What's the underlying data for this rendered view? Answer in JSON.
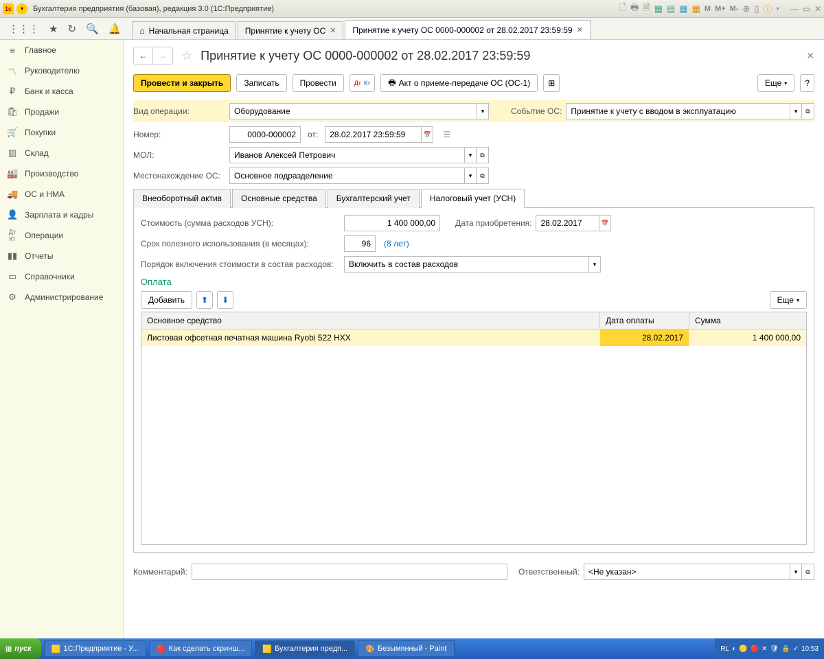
{
  "titlebar": {
    "text": "Бухгалтерия предприятия (базовая), редакция 3.0  (1С:Предприятие)",
    "m_items": [
      "M",
      "M+",
      "M-"
    ]
  },
  "tabs": {
    "home": "Начальная страница",
    "items": [
      "Принятие к учету ОС",
      "Принятие к учету ОС 0000-000002 от 28.02.2017 23:59:59"
    ],
    "active": 1
  },
  "sidebar": [
    {
      "icon": "≡",
      "label": "Главное"
    },
    {
      "icon": "📈",
      "label": "Руководителю"
    },
    {
      "icon": "₽",
      "label": "Банк и касса"
    },
    {
      "icon": "🛍",
      "label": "Продажи"
    },
    {
      "icon": "🛒",
      "label": "Покупки"
    },
    {
      "icon": "📊",
      "label": "Склад"
    },
    {
      "icon": "🏭",
      "label": "Производство"
    },
    {
      "icon": "🚚",
      "label": "ОС и НМА"
    },
    {
      "icon": "👤",
      "label": "Зарплата и кадры"
    },
    {
      "icon": "Дт",
      "label": "Операции"
    },
    {
      "icon": "📶",
      "label": "Отчеты"
    },
    {
      "icon": "📁",
      "label": "Справочники"
    },
    {
      "icon": "⚙",
      "label": "Администрирование"
    }
  ],
  "page": {
    "title": "Принятие к учету ОС 0000-000002 от 28.02.2017 23:59:59"
  },
  "toolbar": {
    "post_close": "Провести и закрыть",
    "write": "Записать",
    "post": "Провести",
    "act": "Акт о приеме-передаче ОС (ОС-1)",
    "more": "Еще",
    "help": "?"
  },
  "form": {
    "operation_label": "Вид операции:",
    "operation_value": "Оборудование",
    "event_label": "Событие ОС:",
    "event_value": "Принятие к учету с вводом в эксплуатацию",
    "number_label": "Номер:",
    "number_value": "0000-000002",
    "from_label": "от:",
    "date_value": "28.02.2017 23:59:59",
    "mol_label": "МОЛ:",
    "mol_value": "Иванов Алексей Петрович",
    "location_label": "Местонахождение ОС:",
    "location_value": "Основное подразделение"
  },
  "inner_tabs": [
    "Внеоборотный актив",
    "Основные средства",
    "Бухгалтерский учет",
    "Налоговый учет (УСН)"
  ],
  "inner_active": 3,
  "tax_panel": {
    "cost_label": "Стоимость (сумма расходов УСН):",
    "cost_value": "1 400 000,00",
    "acq_date_label": "Дата приобретения:",
    "acq_date_value": "28.02.2017",
    "life_label": "Срок полезного использования (в месяцах):",
    "life_value": "96",
    "life_hint": "(8 лет)",
    "order_label": "Порядок включения стоимости в состав расходов:",
    "order_value": "Включить в состав расходов",
    "section": "Оплата",
    "add_btn": "Добавить",
    "more": "Еще"
  },
  "grid": {
    "headers": [
      "Основное средство",
      "Дата оплаты",
      "Сумма"
    ],
    "rows": [
      {
        "os": "Листовая офсетная печатная машина Ryobi 522 HXX",
        "date": "28.02.2017",
        "sum": "1 400 000,00"
      }
    ]
  },
  "footer": {
    "comment_label": "Комментарий:",
    "comment_value": "",
    "responsible_label": "Ответственный:",
    "responsible_value": "<Не указан>"
  },
  "taskbar": {
    "start": "пуск",
    "tasks": [
      "1С:Предприятие - У...",
      "Как сделать скринш...",
      "Бухгалтерия предп...",
      "Безымянный - Paint"
    ],
    "lang": "RL",
    "time": "10:53"
  }
}
